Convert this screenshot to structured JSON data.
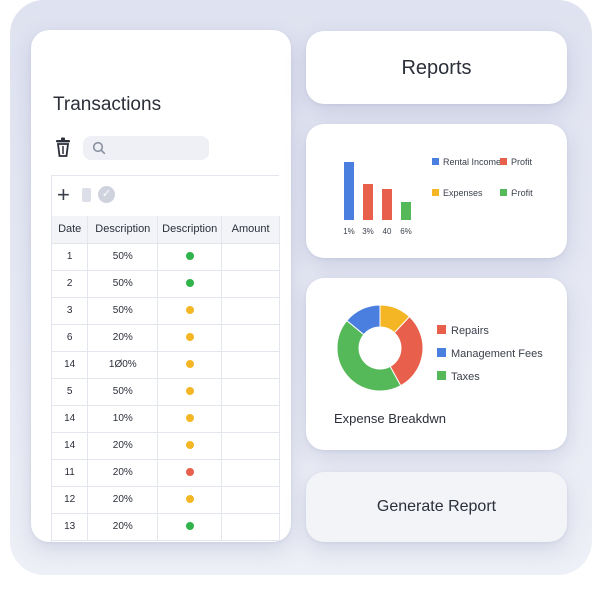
{
  "transactions": {
    "title": "Transactions",
    "search_placeholder": "",
    "columns": [
      "Date",
      "Description",
      "Description",
      "Amount"
    ],
    "rows": [
      {
        "date": "1",
        "desc": "50%",
        "status": "green",
        "amount": ""
      },
      {
        "date": "2",
        "desc": "50%",
        "status": "green",
        "amount": ""
      },
      {
        "date": "3",
        "desc": "50%",
        "status": "yellow",
        "amount": ""
      },
      {
        "date": "6",
        "desc": "20%",
        "status": "yellow",
        "amount": ""
      },
      {
        "date": "14",
        "desc": "1Ø0%",
        "status": "yellow",
        "amount": ""
      },
      {
        "date": "5",
        "desc": "50%",
        "status": "yellow",
        "amount": ""
      },
      {
        "date": "14",
        "desc": "10%",
        "status": "yellow",
        "amount": ""
      },
      {
        "date": "14",
        "desc": "20%",
        "status": "yellow",
        "amount": ""
      },
      {
        "date": "11",
        "desc": "20%",
        "status": "red",
        "amount": ""
      },
      {
        "date": "12",
        "desc": "20%",
        "status": "yellow",
        "amount": ""
      },
      {
        "date": "13",
        "desc": "20%",
        "status": "green",
        "amount": ""
      }
    ]
  },
  "reports": {
    "title": "Reports"
  },
  "colors": {
    "blue": "#4a7fe0",
    "red": "#e8604b",
    "yellow": "#f5b625",
    "green": "#55b95a"
  },
  "status_colors": {
    "green": "#2fb34a",
    "yellow": "#f5b625",
    "red": "#e8604b"
  },
  "chart_data": [
    {
      "type": "bar",
      "categories": [
        "1%",
        "3%",
        "40",
        "6%"
      ],
      "values": [
        58,
        36,
        31,
        18
      ],
      "bar_colors": [
        "#4a7fe0",
        "#e8604b",
        "#e8604b",
        "#55b95a"
      ],
      "legend": [
        {
          "label": "Rental Income",
          "color": "#4a7fe0"
        },
        {
          "label": "Profit",
          "color": "#e8604b"
        },
        {
          "label": "Expenses",
          "color": "#f5b625"
        },
        {
          "label": "Բrofit",
          "color": "#55b95a"
        }
      ],
      "legend_position": "right",
      "ylim": [
        0,
        60
      ]
    },
    {
      "type": "pie",
      "donut": true,
      "slices": [
        {
          "label": "Repairs",
          "value": 30,
          "color": "#e8604b"
        },
        {
          "label": "Taxes",
          "value": 44,
          "color": "#55b95a"
        },
        {
          "label": "Management Fees",
          "value": 14,
          "color": "#4a7fe0"
        },
        {
          "label": "",
          "value": 12,
          "color": "#f5b625"
        }
      ],
      "legend": [
        {
          "label": "Repairs",
          "color": "#e8604b"
        },
        {
          "label": "Management Fees",
          "color": "#4a7fe0"
        },
        {
          "label": "Taxes",
          "color": "#55b95a"
        }
      ],
      "title": "Expense Breakdwn"
    }
  ],
  "generate": {
    "label": "Generate Report"
  }
}
